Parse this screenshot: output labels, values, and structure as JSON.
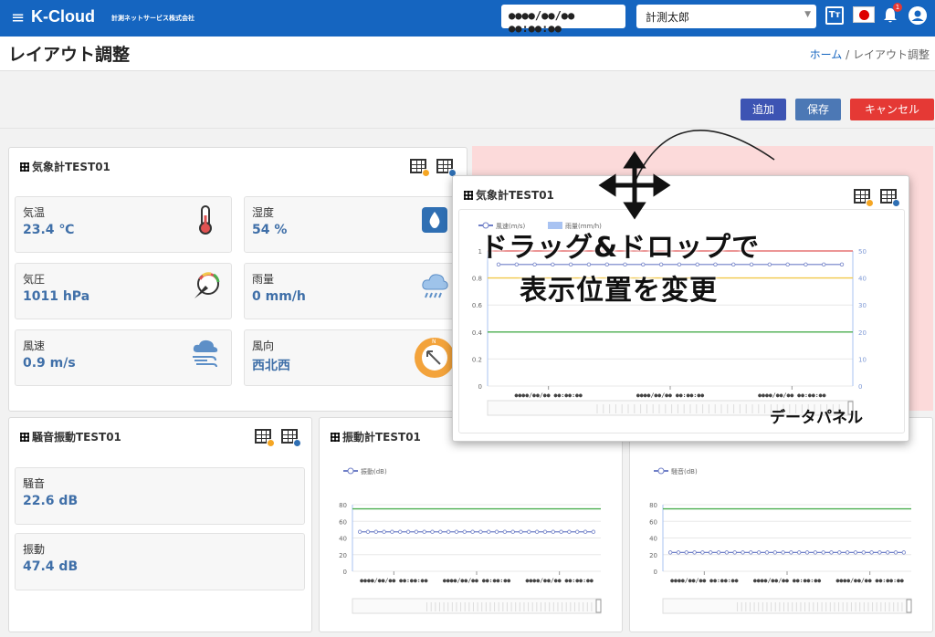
{
  "topbar": {
    "brand": "K-Cloud",
    "company": "計測ネットサービス株式会社",
    "datetime": "●●●●/●●/●● ●●:●●:●●",
    "user": "計測太郎",
    "tt": "Tт",
    "notif_count": "1"
  },
  "page": {
    "title": "レイアウト調整",
    "breadcrumb_home": "ホーム",
    "breadcrumb_sep": "/",
    "breadcrumb_current": "レイアウト調整"
  },
  "actions": {
    "add": "追加",
    "save": "保存",
    "cancel": "キャンセル"
  },
  "weather_card": {
    "title": "気象計TEST01",
    "tiles": [
      {
        "label": "気温",
        "value": "23.4 ℃",
        "icon": "thermometer-icon"
      },
      {
        "label": "湿度",
        "value": "54 %",
        "icon": "water-drop-icon"
      },
      {
        "label": "気圧",
        "value": "1011 hPa",
        "icon": "pressure-gauge-icon"
      },
      {
        "label": "雨量",
        "value": "0 mm/h",
        "icon": "rain-cloud-icon"
      },
      {
        "label": "風速",
        "value": "0.9 m/s",
        "icon": "wind-icon"
      },
      {
        "label": "風向",
        "value": "西北西",
        "icon": "wind-direction-compass-icon"
      }
    ]
  },
  "noise_card": {
    "title": "騒音振動TEST01",
    "tiles": [
      {
        "label": "騒音",
        "value": "22.6 dB"
      },
      {
        "label": "振動",
        "value": "47.4 dB"
      }
    ]
  },
  "vib_card": {
    "title": "振動計TEST01"
  },
  "drag_panel": {
    "title": "気象計TEST01"
  },
  "overlay": {
    "line1": "ドラッグ&ドロップで",
    "line2": "表示位置を変更",
    "panel_label": "データパネル"
  },
  "colors": {
    "header": "#1565c0",
    "add": "#3d54b3",
    "save": "#4c78b5",
    "cancel": "#e53935",
    "dropzone": "#fcdada"
  },
  "chart_data": [
    {
      "type": "line",
      "legend": [
        "風速(m/s)",
        "雨量(mm/h)"
      ],
      "x": [
        "●●●●/●●/●● ●●:●●:●●",
        "●●●●/●●/●● ●●:●●:●●",
        "●●●●/●●/●● ●●:●●:●●"
      ],
      "yticks_left": [
        "1",
        "0.8",
        "0.6",
        "0.4",
        "0.2",
        "0"
      ],
      "yticks_right": [
        "50",
        "40",
        "30",
        "20",
        "10",
        "0"
      ],
      "ylim": [
        0,
        1
      ],
      "y2lim": [
        0,
        50
      ],
      "series": [
        {
          "name": "風速(m/s)",
          "values": [
            0.9,
            0.9,
            0.9,
            0.9,
            0.9,
            0.9,
            0.9,
            0.9,
            0.9,
            0.9,
            0.9,
            0.9,
            0.9,
            0.9,
            0.9,
            0.9,
            0.9,
            0.9,
            0.9,
            0.9
          ]
        }
      ],
      "thresholds": [
        {
          "value": 1,
          "color": "#e57373"
        },
        {
          "value": 0.8,
          "color": "#f2c94c"
        },
        {
          "value": 0.4,
          "color": "#4caf50"
        }
      ]
    },
    {
      "type": "line",
      "legend": [
        "振動(dB)"
      ],
      "x": [
        "●●●●/●●/●● ●●:●●:●●",
        "●●●●/●●/●● ●●:●●:●●",
        "●●●●/●●/●● ●●:●●:●●"
      ],
      "yticks_left": [
        "80",
        "60",
        "40",
        "20",
        "0"
      ],
      "ylim": [
        0,
        80
      ],
      "series": [
        {
          "name": "振動(dB)",
          "values": [
            47.4,
            47.4,
            47.4,
            47.4,
            47.4,
            47.4,
            47.4,
            47.4,
            47.4,
            47.4,
            47.4,
            47.4,
            47.4,
            47.4,
            47.4,
            47.4,
            47.4,
            47.4,
            47.4,
            47.4,
            47.4,
            47.4,
            47.4,
            47.4,
            47.4,
            47.4,
            47.4,
            47.4,
            47.4,
            47.4
          ]
        }
      ],
      "thresholds": [
        {
          "value": 75,
          "color": "#4caf50"
        }
      ]
    },
    {
      "type": "line",
      "legend": [
        "騒音(dB)"
      ],
      "x": [
        "●●●●/●●/●● ●●:●●:●●",
        "●●●●/●●/●● ●●:●●:●●",
        "●●●●/●●/●● ●●:●●:●●"
      ],
      "yticks_left": [
        "80",
        "60",
        "40",
        "20",
        "0"
      ],
      "ylim": [
        0,
        80
      ],
      "series": [
        {
          "name": "騒音(dB)",
          "values": [
            22.6,
            22.6,
            22.6,
            22.6,
            22.6,
            22.6,
            22.6,
            22.6,
            22.6,
            22.6,
            22.6,
            22.6,
            22.6,
            22.6,
            22.6,
            22.6,
            22.6,
            22.6,
            22.6,
            22.6,
            22.6,
            22.6,
            22.6,
            22.6,
            22.6,
            22.6,
            22.6,
            22.6,
            22.6,
            22.6
          ]
        }
      ],
      "thresholds": [
        {
          "value": 75,
          "color": "#4caf50"
        }
      ]
    }
  ]
}
